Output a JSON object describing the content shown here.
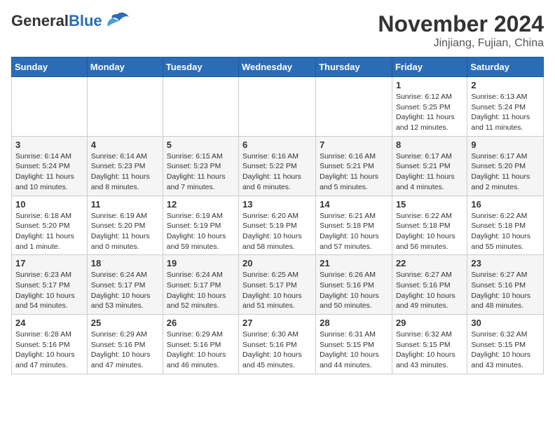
{
  "header": {
    "logo_general": "General",
    "logo_blue": "Blue",
    "month_year": "November 2024",
    "location": "Jinjiang, Fujian, China"
  },
  "days_of_week": [
    "Sunday",
    "Monday",
    "Tuesday",
    "Wednesday",
    "Thursday",
    "Friday",
    "Saturday"
  ],
  "weeks": [
    [
      {
        "day": "",
        "info": ""
      },
      {
        "day": "",
        "info": ""
      },
      {
        "day": "",
        "info": ""
      },
      {
        "day": "",
        "info": ""
      },
      {
        "day": "",
        "info": ""
      },
      {
        "day": "1",
        "info": "Sunrise: 6:12 AM\nSunset: 5:25 PM\nDaylight: 11 hours and 12 minutes."
      },
      {
        "day": "2",
        "info": "Sunrise: 6:13 AM\nSunset: 5:24 PM\nDaylight: 11 hours and 11 minutes."
      }
    ],
    [
      {
        "day": "3",
        "info": "Sunrise: 6:14 AM\nSunset: 5:24 PM\nDaylight: 11 hours and 10 minutes."
      },
      {
        "day": "4",
        "info": "Sunrise: 6:14 AM\nSunset: 5:23 PM\nDaylight: 11 hours and 8 minutes."
      },
      {
        "day": "5",
        "info": "Sunrise: 6:15 AM\nSunset: 5:23 PM\nDaylight: 11 hours and 7 minutes."
      },
      {
        "day": "6",
        "info": "Sunrise: 6:16 AM\nSunset: 5:22 PM\nDaylight: 11 hours and 6 minutes."
      },
      {
        "day": "7",
        "info": "Sunrise: 6:16 AM\nSunset: 5:21 PM\nDaylight: 11 hours and 5 minutes."
      },
      {
        "day": "8",
        "info": "Sunrise: 6:17 AM\nSunset: 5:21 PM\nDaylight: 11 hours and 4 minutes."
      },
      {
        "day": "9",
        "info": "Sunrise: 6:17 AM\nSunset: 5:20 PM\nDaylight: 11 hours and 2 minutes."
      }
    ],
    [
      {
        "day": "10",
        "info": "Sunrise: 6:18 AM\nSunset: 5:20 PM\nDaylight: 11 hours and 1 minute."
      },
      {
        "day": "11",
        "info": "Sunrise: 6:19 AM\nSunset: 5:20 PM\nDaylight: 11 hours and 0 minutes."
      },
      {
        "day": "12",
        "info": "Sunrise: 6:19 AM\nSunset: 5:19 PM\nDaylight: 10 hours and 59 minutes."
      },
      {
        "day": "13",
        "info": "Sunrise: 6:20 AM\nSunset: 5:19 PM\nDaylight: 10 hours and 58 minutes."
      },
      {
        "day": "14",
        "info": "Sunrise: 6:21 AM\nSunset: 5:18 PM\nDaylight: 10 hours and 57 minutes."
      },
      {
        "day": "15",
        "info": "Sunrise: 6:22 AM\nSunset: 5:18 PM\nDaylight: 10 hours and 56 minutes."
      },
      {
        "day": "16",
        "info": "Sunrise: 6:22 AM\nSunset: 5:18 PM\nDaylight: 10 hours and 55 minutes."
      }
    ],
    [
      {
        "day": "17",
        "info": "Sunrise: 6:23 AM\nSunset: 5:17 PM\nDaylight: 10 hours and 54 minutes."
      },
      {
        "day": "18",
        "info": "Sunrise: 6:24 AM\nSunset: 5:17 PM\nDaylight: 10 hours and 53 minutes."
      },
      {
        "day": "19",
        "info": "Sunrise: 6:24 AM\nSunset: 5:17 PM\nDaylight: 10 hours and 52 minutes."
      },
      {
        "day": "20",
        "info": "Sunrise: 6:25 AM\nSunset: 5:17 PM\nDaylight: 10 hours and 51 minutes."
      },
      {
        "day": "21",
        "info": "Sunrise: 6:26 AM\nSunset: 5:16 PM\nDaylight: 10 hours and 50 minutes."
      },
      {
        "day": "22",
        "info": "Sunrise: 6:27 AM\nSunset: 5:16 PM\nDaylight: 10 hours and 49 minutes."
      },
      {
        "day": "23",
        "info": "Sunrise: 6:27 AM\nSunset: 5:16 PM\nDaylight: 10 hours and 48 minutes."
      }
    ],
    [
      {
        "day": "24",
        "info": "Sunrise: 6:28 AM\nSunset: 5:16 PM\nDaylight: 10 hours and 47 minutes."
      },
      {
        "day": "25",
        "info": "Sunrise: 6:29 AM\nSunset: 5:16 PM\nDaylight: 10 hours and 47 minutes."
      },
      {
        "day": "26",
        "info": "Sunrise: 6:29 AM\nSunset: 5:16 PM\nDaylight: 10 hours and 46 minutes."
      },
      {
        "day": "27",
        "info": "Sunrise: 6:30 AM\nSunset: 5:16 PM\nDaylight: 10 hours and 45 minutes."
      },
      {
        "day": "28",
        "info": "Sunrise: 6:31 AM\nSunset: 5:15 PM\nDaylight: 10 hours and 44 minutes."
      },
      {
        "day": "29",
        "info": "Sunrise: 6:32 AM\nSunset: 5:15 PM\nDaylight: 10 hours and 43 minutes."
      },
      {
        "day": "30",
        "info": "Sunrise: 6:32 AM\nSunset: 5:15 PM\nDaylight: 10 hours and 43 minutes."
      }
    ]
  ]
}
